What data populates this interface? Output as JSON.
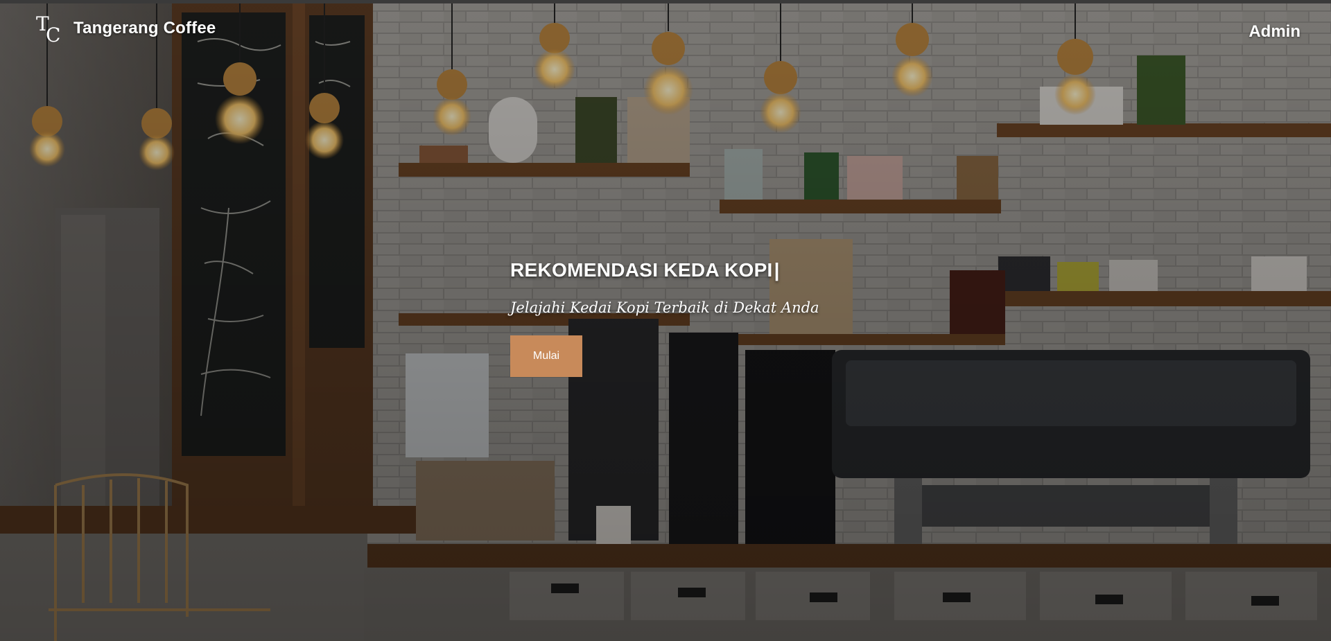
{
  "brand": {
    "monogram": "TC",
    "name": "Tangerang Coffee"
  },
  "nav": {
    "admin_label": "Admin"
  },
  "hero": {
    "title": "REKOMENDASI KEDA KOPI",
    "cursor": "|",
    "subtitle": "Jelajahi Kedai Kopi Terbaik di Dekat Anda",
    "button_label": "Mulai",
    "background_image": "coffee-shop-interior-photo"
  },
  "colors": {
    "accent": "#c88a5a",
    "text": "#ffffff"
  }
}
